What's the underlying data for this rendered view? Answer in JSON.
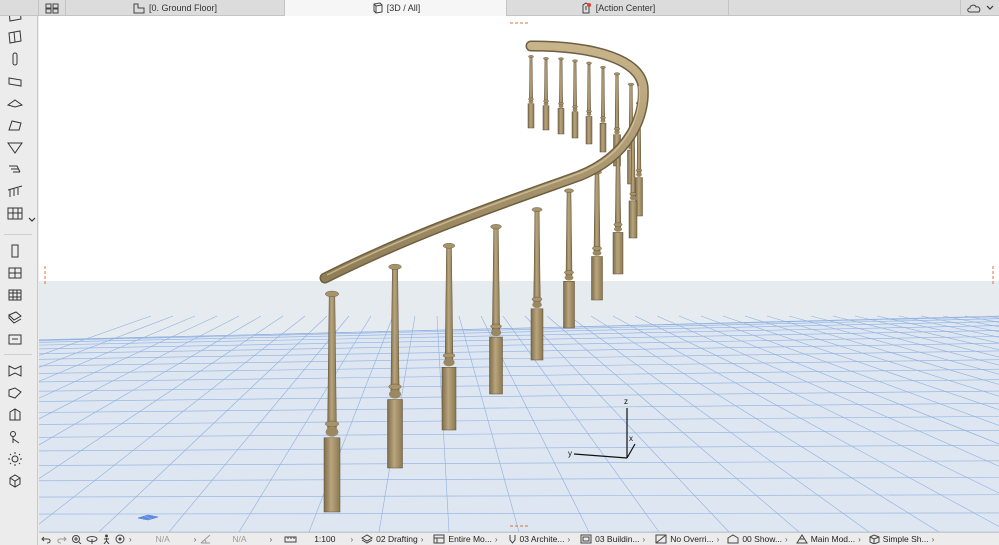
{
  "tabs": [
    {
      "label": "[0. Ground Floor]",
      "icon": "floor-plan-icon"
    },
    {
      "label": "[3D / All]",
      "icon": "3d-box-icon"
    },
    {
      "label": "[Action Center]",
      "icon": "action-center-icon"
    }
  ],
  "viewport": {
    "axis_labels": {
      "z": "z",
      "x": "x",
      "y": "y"
    }
  },
  "statusbar": {
    "na_left": "N/A",
    "na_right": "N/A",
    "scale": "1:100",
    "layer_combo": "02 Drafting",
    "model_view": "Entire Mo...",
    "pen_set": "03 Archite...",
    "mvo": "03 Buildin...",
    "override": "No Overri...",
    "renovation": "00 Show...",
    "structure": "Main Mod...",
    "display": "Simple Sh..."
  }
}
